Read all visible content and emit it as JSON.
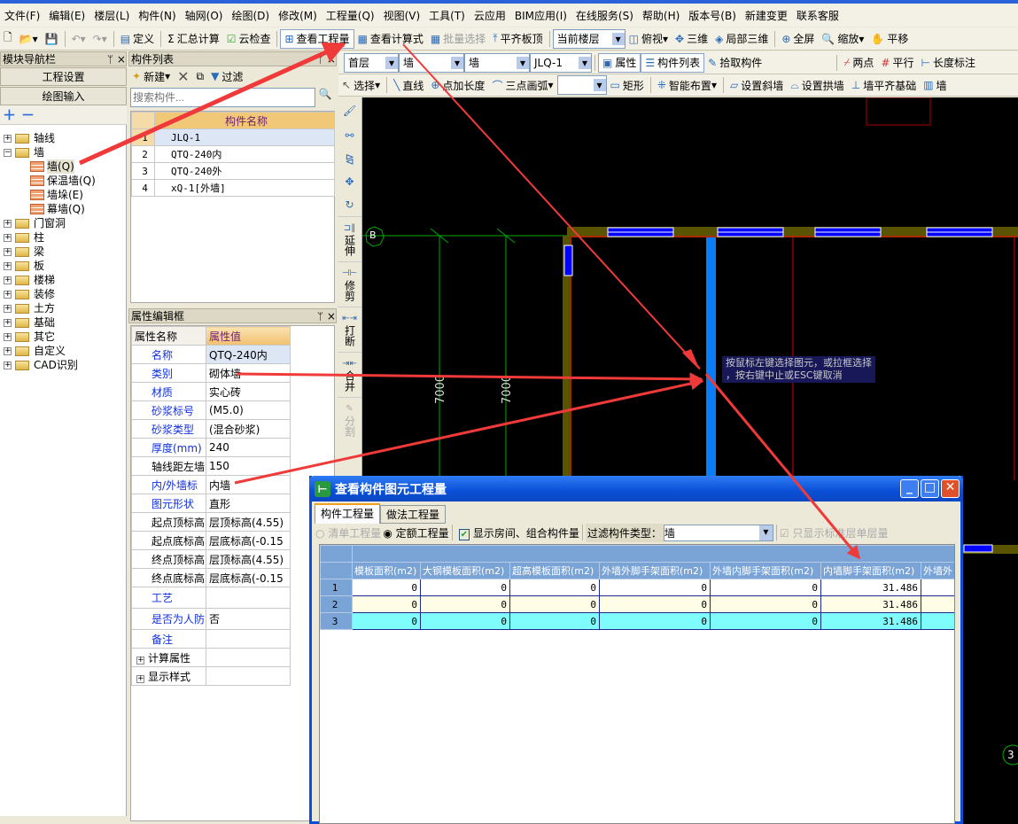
{
  "menu": [
    "文件(F)",
    "编辑(E)",
    "楼层(L)",
    "构件(N)",
    "轴网(O)",
    "绘图(D)",
    "修改(M)",
    "工程量(Q)",
    "视图(V)",
    "工具(T)",
    "云应用",
    "BIM应用(I)",
    "在线服务(S)",
    "帮助(H)",
    "版本号(B)",
    "新建变更",
    "联系客服"
  ],
  "toolbar1": {
    "define": "定义",
    "sum": "汇总计算",
    "cloud_check": "云检查",
    "view_qty": "查看工程量",
    "view_formula": "查看计算式",
    "batch_select": "批量选择",
    "align_top": "平齐板顶",
    "floor_select": "当前楼层",
    "top_view": "俯视",
    "three_d": "三维",
    "local_3d": "局部三维",
    "fullscreen": "全屏",
    "zoom": "缩放",
    "pan": "平移"
  },
  "nav": {
    "title": "模块导航栏",
    "project_settings": "工程设置",
    "drawing_input": "绘图输入",
    "tree": [
      "轴线",
      "墙",
      "墙(Q)",
      "保温墙(Q)",
      "墙垛(E)",
      "幕墙(Q)",
      "门窗洞",
      "柱",
      "梁",
      "板",
      "楼梯",
      "装修",
      "土方",
      "基础",
      "其它",
      "自定义",
      "CAD识别"
    ]
  },
  "comp_list": {
    "title": "构件列表",
    "new": "新建",
    "filter": "过滤",
    "search_placeholder": "搜索构件...",
    "col": "构件名称",
    "rows": [
      "JLQ-1",
      "QTQ-240内",
      "QTQ-240外",
      "xQ-1[外墙]"
    ]
  },
  "props": {
    "title": "属性编辑框",
    "col_name": "属性名称",
    "col_value": "属性值",
    "rows": [
      [
        "名称",
        "QTQ-240内"
      ],
      [
        "类别",
        "砌体墙"
      ],
      [
        "材质",
        "实心砖"
      ],
      [
        "砂浆标号",
        "(M5.0)"
      ],
      [
        "砂浆类型",
        "(混合砂浆)"
      ],
      [
        "厚度(mm)",
        "240"
      ],
      [
        "轴线距左墙",
        "150"
      ],
      [
        "内/外墙标",
        "内墙"
      ],
      [
        "图元形状",
        "直形"
      ],
      [
        "起点顶标高",
        "层顶标高(4.55)"
      ],
      [
        "起点底标高",
        "层底标高(-0.15"
      ],
      [
        "终点顶标高",
        "层顶标高(4.55)"
      ],
      [
        "终点底标高",
        "层底标高(-0.15"
      ],
      [
        "工艺",
        ""
      ],
      [
        "是否为人防",
        "否"
      ],
      [
        "备注",
        ""
      ],
      [
        "计算属性",
        ""
      ],
      [
        "显示样式",
        ""
      ]
    ]
  },
  "toolbar2": {
    "floor": "首层",
    "type1": "墙",
    "type2": "墙",
    "comp": "JLQ-1",
    "attr": "属性",
    "comp_list": "构件列表",
    "pick": "拾取构件",
    "two_point": "两点",
    "parallel": "平行",
    "dim": "长度标注"
  },
  "toolbar3": {
    "select": "选择",
    "line": "直线",
    "point_len": "点加长度",
    "arc": "三点画弧",
    "rect": "矩形",
    "smart": "智能布置",
    "slope": "设置斜墙",
    "arch": "设置拱墙",
    "align_base": "墙平齐基础",
    "wall": "墙"
  },
  "vtools": [
    "延伸",
    "修剪",
    "打断",
    "合并",
    "分割"
  ],
  "canvas": {
    "axis_label": "B",
    "dim1": "7000",
    "dim2": "7000",
    "axis_label2": "3",
    "tooltip1": "按鼠标左键选择图元，或拉框选择",
    "tooltip2": "，按右键中止或ESC键取消"
  },
  "dialog": {
    "title": "查看构件图元工程量",
    "tabs": [
      "构件工程量",
      "做法工程量"
    ],
    "opt_list": "清单工程量",
    "opt_quota": "定额工程量",
    "show_rooms": "显示房间、组合构件量",
    "filter_label": "过滤构件类型：",
    "filter_value": "墙",
    "std_floor": "只显示标准层单层量",
    "columns": [
      "模板面积(m2)",
      "大钢模板面积(m2)",
      "超高模板面积(m2)",
      "外墙外脚手架面积(m2)",
      "外墙内脚手架面积(m2)",
      "内墙脚手架面积(m2)",
      "外墙外"
    ],
    "rows": [
      [
        "1",
        "0",
        "0",
        "0",
        "0",
        "0",
        "31.486",
        ""
      ],
      [
        "2",
        "0",
        "0",
        "0",
        "0",
        "0",
        "31.486",
        ""
      ],
      [
        "3",
        "0",
        "0",
        "0",
        "0",
        "0",
        "31.486",
        ""
      ]
    ]
  },
  "colors": {
    "annotation_arrow": "#f03a3a",
    "canvas_bg": "#000000",
    "selected_wall": "#0a7cf5",
    "wall": "#5a5400",
    "dialog_title": "#0a4fd6"
  }
}
